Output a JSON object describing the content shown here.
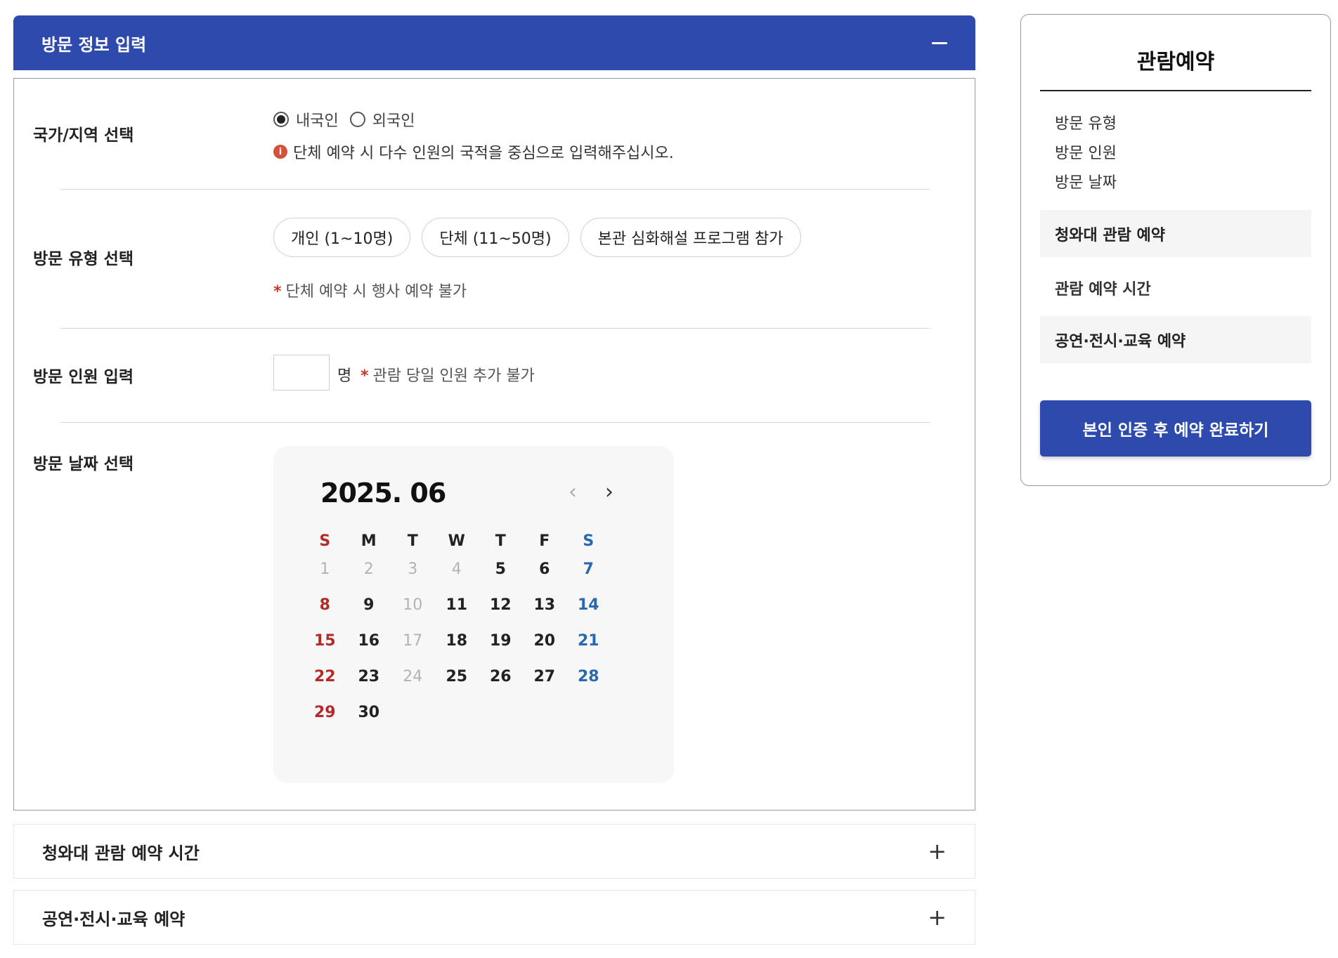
{
  "visit_section": {
    "title": "방문 정보 입력",
    "nationality": {
      "label": "국가/지역 선택",
      "options": [
        "내국인",
        "외국인"
      ],
      "selected": "내국인",
      "notice": "단체 예약 시 다수 인원의 국적을 중심으로 입력해주십시오."
    },
    "visit_type": {
      "label": "방문 유형 선택",
      "options": [
        "개인 (1~10명)",
        "단체 (11~50명)",
        "본관 심화해설 프로그램 참가"
      ],
      "note": "단체 예약 시 행사 예약 불가"
    },
    "visitors": {
      "label": "방문 인원 입력",
      "value": "",
      "unit": "명",
      "note": "관람 당일 인원 추가 불가"
    },
    "date": {
      "label": "방문 날짜 선택",
      "month_title": "2025. 06",
      "weekdays": [
        "S",
        "M",
        "T",
        "W",
        "T",
        "F",
        "S"
      ],
      "weeks": [
        [
          "1",
          "2",
          "3",
          "4",
          "5",
          "6",
          "7"
        ],
        [
          "8",
          "9",
          "10",
          "11",
          "12",
          "13",
          "14"
        ],
        [
          "15",
          "16",
          "17",
          "18",
          "19",
          "20",
          "21"
        ],
        [
          "22",
          "23",
          "24",
          "25",
          "26",
          "27",
          "28"
        ],
        [
          "29",
          "30",
          "",
          "",
          "",
          "",
          ""
        ]
      ],
      "disabled_days": [
        "1",
        "2",
        "3",
        "4",
        "10",
        "17",
        "24"
      ]
    }
  },
  "collapsed_sections": [
    "청와대 관람 예약 시간",
    "공연·전시·교육 예약"
  ],
  "sidebar": {
    "title": "관람예약",
    "summary_items": [
      "방문 유형",
      "방문 인원",
      "방문 날짜"
    ],
    "steps": [
      "청와대 관람 예약",
      "관람 예약 시간",
      "공연·전시·교육 예약"
    ],
    "cta_label": "본인 인증 후 예약 완료하기"
  },
  "colors": {
    "primary": "#2e4aad",
    "sunday": "#b22a2a",
    "saturday": "#2a68b0",
    "alert": "#d2533a"
  }
}
